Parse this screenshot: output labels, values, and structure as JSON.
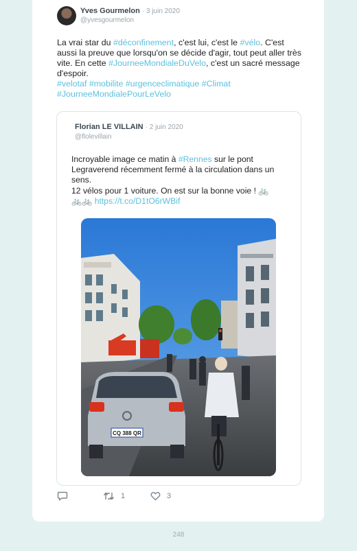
{
  "tweet": {
    "author_name": "Yves Gourmelon",
    "date": "· 3 juin 2020",
    "handle": "@yvesgourmelon",
    "text_1": "La vrai star du ",
    "tag_deconfinement": "#déconfinement",
    "text_2": ", c'est lui, c'est le ",
    "tag_velo": "#vélo",
    "text_3": ". C'est aussi la preuve que lorsqu'on se décide d'agir, tout peut aller très vite. En cette ",
    "tag_journee": "#JourneeMondialeDuVelo",
    "text_4": ", c'est un sacré message d'espoir.",
    "tags_line": "#velotaf #mobilite #urgenceclimatique #Climat",
    "tags_line_2": "#JourneeMondialePourLeVelo"
  },
  "quoted": {
    "author_name": "Florian LE VILLAIN",
    "date": "· 2 juin 2020",
    "handle": "@flolevillain",
    "text_1": "Incroyable image ce matin à ",
    "tag_rennes": "#Rennes",
    "text_2": " sur le pont Legraverend récemment fermé à la circulation dans un sens.",
    "text_3": "12 vélos pour 1 voiture. On est sur la bonne voie ! ",
    "bike_emoji": "🚲",
    "bike_emoji_2": "🚲🚲",
    "link": "https://t.co/D1tO6rWBif",
    "photo_plate": "CQ 388 QR"
  },
  "actions": {
    "reply_count": "",
    "retweet_count": "1",
    "like_count": "3"
  },
  "page_number": "248"
}
